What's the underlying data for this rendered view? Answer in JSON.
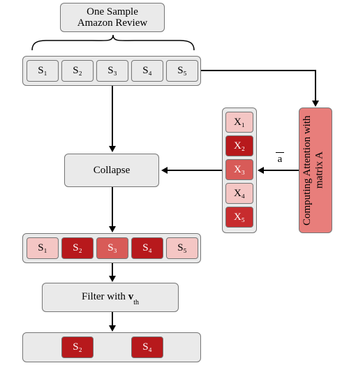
{
  "header": {
    "title": "One Sample\nAmazon Review"
  },
  "row1": [
    {
      "label": "S₁"
    },
    {
      "label": "S₂"
    },
    {
      "label": "S₃"
    },
    {
      "label": "S₄"
    },
    {
      "label": "S₅"
    }
  ],
  "attention": {
    "line1": "Computing Attention",
    "line2": "with matrix A"
  },
  "labels": {
    "a_bar": "a"
  },
  "xcol": [
    {
      "label": "X₁",
      "shade": "light"
    },
    {
      "label": "X₂",
      "shade": "dark"
    },
    {
      "label": "X₃",
      "shade": "med"
    },
    {
      "label": "X₄",
      "shade": "light"
    },
    {
      "label": "X₅",
      "shade": "dark2"
    }
  ],
  "ops": {
    "collapse": "Collapse",
    "filter_pre": "Filter with ",
    "filter_var": "v",
    "filter_sub": "th"
  },
  "row2": [
    {
      "label": "S₁",
      "shade": "light"
    },
    {
      "label": "S₂",
      "shade": "dark"
    },
    {
      "label": "S₃",
      "shade": "med"
    },
    {
      "label": "S₄",
      "shade": "dark"
    },
    {
      "label": "S₅",
      "shade": "light"
    }
  ],
  "row3": [
    {
      "label": "S₂"
    },
    {
      "label": "S₄"
    }
  ],
  "colors": {
    "light": "#f4c6c4",
    "med": "#d85b58",
    "dark": "#b7191c",
    "dark2": "#c72c2e",
    "panel": "#eaeaea",
    "attn": "#e87e7b"
  }
}
